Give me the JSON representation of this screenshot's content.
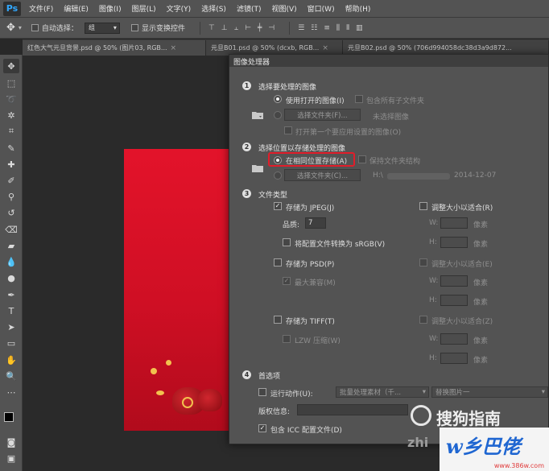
{
  "app": {
    "logo": "Ps"
  },
  "menubar": {
    "items": [
      "文件(F)",
      "编辑(E)",
      "图像(I)",
      "图层(L)",
      "文字(Y)",
      "选择(S)",
      "滤镜(T)",
      "视图(V)",
      "窗口(W)",
      "帮助(H)"
    ]
  },
  "options": {
    "auto_select_label": "自动选择：",
    "auto_select_value": "组",
    "show_transform_label": "显示变换控件"
  },
  "tabs": [
    {
      "label": "红色大气元旦背景.psd @ 50% (图片03, RGB..."
    },
    {
      "label": "元旦B01.psd @ 50% (dcxb, RGB..."
    },
    {
      "label": "元旦B02.psd @ 50% (706d994058dc38d3a9d872..."
    }
  ],
  "dialog": {
    "title": "图像处理器",
    "section1": {
      "num": "1",
      "title": "选择要处理的图像",
      "use_open_label": "使用打开的图像(I)",
      "include_subfolders_label": "包含所有子文件夹",
      "select_folder_button": "选择文件夹(F)...",
      "no_image_selected": "未选择图像",
      "open_first_label": "打开第一个要应用设置的图像(O)"
    },
    "section2": {
      "num": "2",
      "title": "选择位置以存储处理的图像",
      "same_location_label": "在相同位置存储(A)",
      "keep_structure_label": "保持文件夹结构",
      "select_folder_button": "选择文件夹(C)...",
      "path_text": "H:\\",
      "date_text": "2014-12-07"
    },
    "section3": {
      "num": "3",
      "title": "文件类型",
      "save_jpeg_label": "存储为 JPEG(J)",
      "resize_jpeg_label": "调整大小以适合(R)",
      "quality_label": "品质:",
      "quality_value": "7",
      "w_label": "W:",
      "h_label": "H:",
      "px_label": "像素",
      "convert_srgb_label": "将配置文件转换为 sRGB(V)",
      "save_psd_label": "存储为 PSD(P)",
      "resize_psd_label": "调整大小以适合(E)",
      "maximize_compat_label": "最大兼容(M)",
      "save_tiff_label": "存储为 TIFF(T)",
      "resize_tiff_label": "调整大小以适合(Z)",
      "lzw_label": "LZW 压缩(W)"
    },
    "section4": {
      "num": "4",
      "title": "首选项",
      "run_action_label": "运行动作(U):",
      "action_set_value": "批量处理素材（千...",
      "action_value": "替换图片一",
      "copyright_label": "版权信息:",
      "icc_label": "包含 ICC 配置文件(D)"
    }
  },
  "watermarks": {
    "sogou_text": "搜狗指南",
    "zhi_text": "zhi",
    "site_logo": "w乡巴佬",
    "site_url": "www.386w.com"
  },
  "colors": {
    "highlight": "#e11d2a",
    "artboard_red": "#d8102a"
  }
}
